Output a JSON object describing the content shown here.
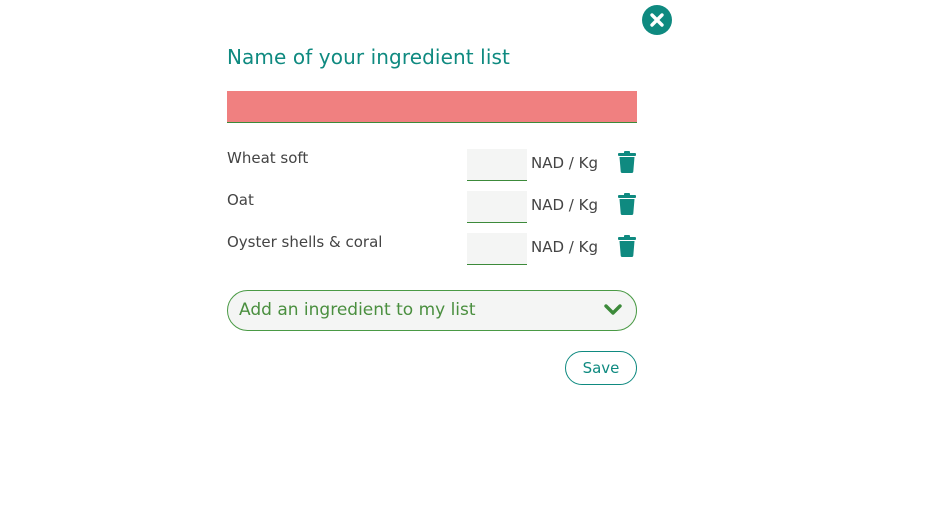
{
  "dialog": {
    "title": "Name of your ingredient list",
    "list_name_value": "",
    "close_icon": "close-circle-icon",
    "accent_color": "#0f8a80",
    "error_color": "#f08080"
  },
  "ingredients": [
    {
      "name": "Wheat soft",
      "price": "",
      "unit": "NAD / Kg"
    },
    {
      "name": "Oat",
      "price": "",
      "unit": "NAD / Kg"
    },
    {
      "name": "Oyster shells & coral",
      "price": "",
      "unit": "NAD / Kg"
    }
  ],
  "add_ingredient": {
    "label": "Add an ingredient to my list",
    "icon": "chevron-down-icon"
  },
  "actions": {
    "save_label": "Save"
  }
}
